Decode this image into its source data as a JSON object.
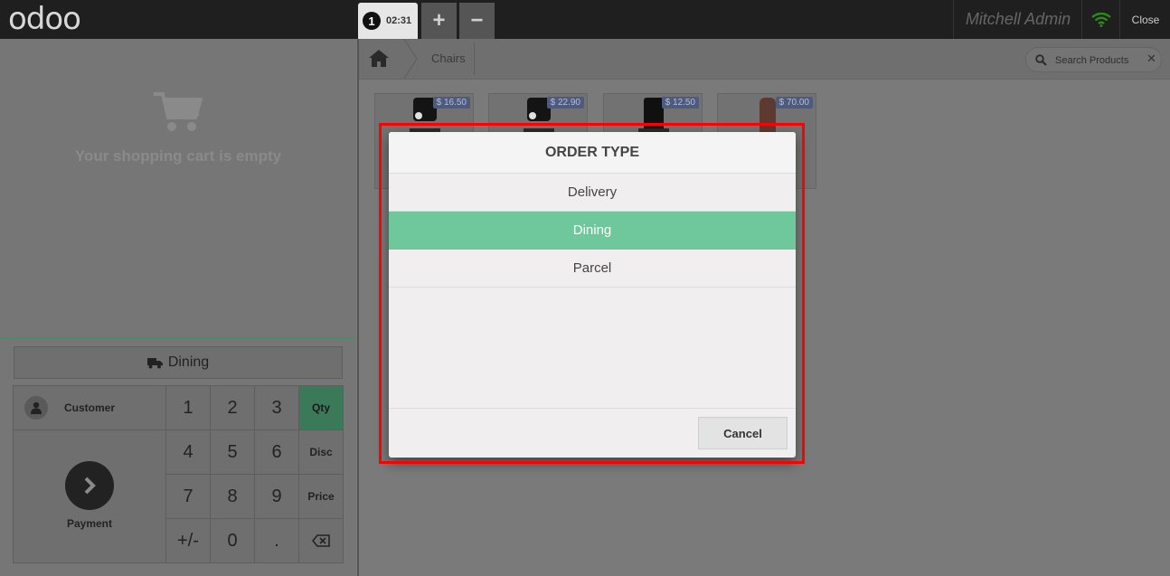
{
  "app": {
    "logo_text": "odoo"
  },
  "topbar": {
    "order_number": "1",
    "order_time": "02:31",
    "add_order": "+",
    "remove_order": "−",
    "user_name": "Mitchell Admin",
    "close_label": "Close"
  },
  "cart": {
    "empty_message": "Your shopping cart is empty"
  },
  "controls": {
    "order_type_button": "Dining",
    "customer_label": "Customer",
    "payment_label": "Payment",
    "numpad": [
      "1",
      "2",
      "3",
      "4",
      "5",
      "6",
      "7",
      "8",
      "9",
      "+/-",
      "0",
      "."
    ],
    "modes": [
      "Qty",
      "Disc",
      "Price"
    ],
    "active_mode": "Qty"
  },
  "products": {
    "breadcrumb": "Chairs",
    "search_placeholder": "Search Products",
    "search_clear": "✕",
    "items": [
      {
        "price": "$ 16.50"
      },
      {
        "price": "$ 22.90"
      },
      {
        "price": "$ 12.50"
      },
      {
        "price": "$ 70.00"
      }
    ]
  },
  "popup": {
    "title": "ORDER TYPE",
    "options": [
      "Delivery",
      "Dining",
      "Parcel"
    ],
    "selected": "Dining",
    "cancel_label": "Cancel"
  },
  "colors": {
    "accent_green": "#6ec89b",
    "highlight_red": "#ff0000",
    "topbar": "#1f1f1f"
  }
}
